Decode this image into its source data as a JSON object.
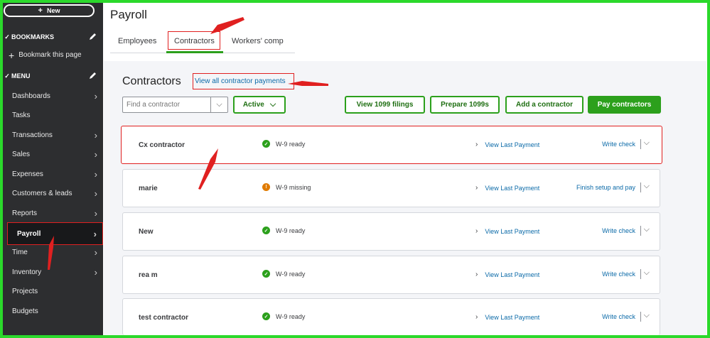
{
  "sidebar": {
    "new_label": "New",
    "bookmarks_label": "BOOKMARKS",
    "bookmark_this_page": "Bookmark this page",
    "menu_label": "MENU",
    "items": [
      {
        "label": "Dashboards",
        "chevron": true
      },
      {
        "label": "Tasks",
        "chevron": false
      },
      {
        "label": "Transactions",
        "chevron": true
      },
      {
        "label": "Sales",
        "chevron": true
      },
      {
        "label": "Expenses",
        "chevron": true
      },
      {
        "label": "Customers & leads",
        "chevron": true
      },
      {
        "label": "Reports",
        "chevron": true
      },
      {
        "label": "Payroll",
        "chevron": true,
        "active": true
      },
      {
        "label": "Time",
        "chevron": true
      },
      {
        "label": "Inventory",
        "chevron": true
      },
      {
        "label": "Projects",
        "chevron": false
      },
      {
        "label": "Budgets",
        "chevron": false
      }
    ]
  },
  "header": {
    "title": "Payroll",
    "tabs": [
      {
        "label": "Employees"
      },
      {
        "label": "Contractors",
        "active": true
      },
      {
        "label": "Workers' comp"
      }
    ]
  },
  "contractors": {
    "title": "Contractors",
    "view_all_link": "View all contractor payments",
    "search_placeholder": "Find a contractor",
    "filter_label": "Active",
    "buttons": {
      "view_1099": "View 1099 filings",
      "prepare_1099": "Prepare 1099s",
      "add_contractor": "Add a contractor",
      "pay_contractors": "Pay contractors"
    },
    "rows": [
      {
        "name": "Cx contractor",
        "status": "W-9 ready",
        "status_type": "ok",
        "last_payment": "View Last Payment",
        "action": "Write check"
      },
      {
        "name": "marie",
        "status": "W-9 missing",
        "status_type": "warn",
        "last_payment": "View Last Payment",
        "action": "Finish setup and pay"
      },
      {
        "name": "New",
        "status": "W-9 ready",
        "status_type": "ok",
        "last_payment": "View Last Payment",
        "action": "Write check"
      },
      {
        "name": "rea m",
        "status": "W-9 ready",
        "status_type": "ok",
        "last_payment": "View Last Payment",
        "action": "Write check"
      },
      {
        "name": "test contractor",
        "status": "W-9 ready",
        "status_type": "ok",
        "last_payment": "View Last Payment",
        "action": "Write check"
      }
    ]
  },
  "colors": {
    "sidebar_bg": "#2d2e30",
    "brand_green": "#2ca01c",
    "link_blue": "#0b6aa8",
    "annotation_red": "#e02020",
    "warning_orange": "#e07b00",
    "frame_green": "#2bd92b"
  },
  "icons": {
    "new": "plus-icon",
    "bookmarks_edit": "pencil-icon",
    "menu_edit": "pencil-icon",
    "nav": "chevron-right-icon",
    "filter": "chevron-down-icon",
    "status_ok": "check-circle-icon",
    "status_warn": "exclamation-circle-icon"
  }
}
